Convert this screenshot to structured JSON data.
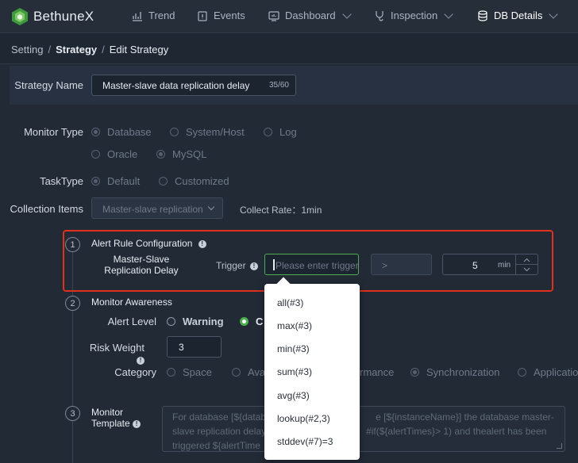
{
  "brand": {
    "name": "BethuneX"
  },
  "nav": [
    {
      "label": "Trend",
      "icon": "trend-icon"
    },
    {
      "label": "Events",
      "icon": "events-icon"
    },
    {
      "label": "Dashboard",
      "icon": "dashboard-icon"
    },
    {
      "label": "Inspection",
      "icon": "inspection-icon"
    },
    {
      "label": "DB Details",
      "icon": "database-icon"
    }
  ],
  "breadcrumb": {
    "a": "Setting",
    "b": "Strategy",
    "c": "Edit Strategy",
    "sep": "/"
  },
  "strategy": {
    "label": "Strategy Name",
    "value": "Master-slave data replication delay",
    "counter": "35/60"
  },
  "monitor_type": {
    "label": "Monitor Type",
    "options": [
      "Database",
      "System/Host",
      "Log"
    ],
    "db_options": [
      "Oracle",
      "MySQL"
    ]
  },
  "task_type": {
    "label": "TaskType",
    "options": [
      "Default",
      "Customized"
    ]
  },
  "collection": {
    "label": "Collection Items",
    "value": "Master-slave replication",
    "rate": "Collect Rate：1min"
  },
  "steps": {
    "s1": {
      "num": "1",
      "title": "Alert Rule Configuration"
    },
    "s2": {
      "num": "2",
      "title": "Monitor Awareness"
    },
    "s3": {
      "num": "3",
      "title_1": "Monitor",
      "title_2": "Template"
    }
  },
  "alert_rule": {
    "metric_1": "Master-Slave",
    "metric_2": "Replication Delay",
    "trigger_label": "Trigger",
    "trigger_placeholder": "Please enter trigger",
    "operator": ">",
    "duration": "5",
    "unit": "min"
  },
  "trigger_options": [
    "all(#3)",
    "max(#3)",
    "min(#3)",
    "sum(#3)",
    "avg(#3)",
    "lookup(#2,3)",
    "stddev(#7)=3"
  ],
  "awareness": {
    "alert_level_label": "Alert Level",
    "levels": [
      "Warning",
      "C"
    ],
    "risk_label": "Risk Weight",
    "risk_value": "3",
    "category_label": "Category",
    "categories": [
      "Space",
      "Ava",
      "rmance",
      "Synchronization",
      "Application"
    ]
  },
  "template_text": {
    "line1a": "For database [${datab",
    "line1b": "e [${instanceName}] the database master-",
    "line2a": "slave replication delay",
    "line2b": "#if(${alertTimes}> 1) and thealert has been",
    "line3a": "triggered ${alertTime"
  }
}
